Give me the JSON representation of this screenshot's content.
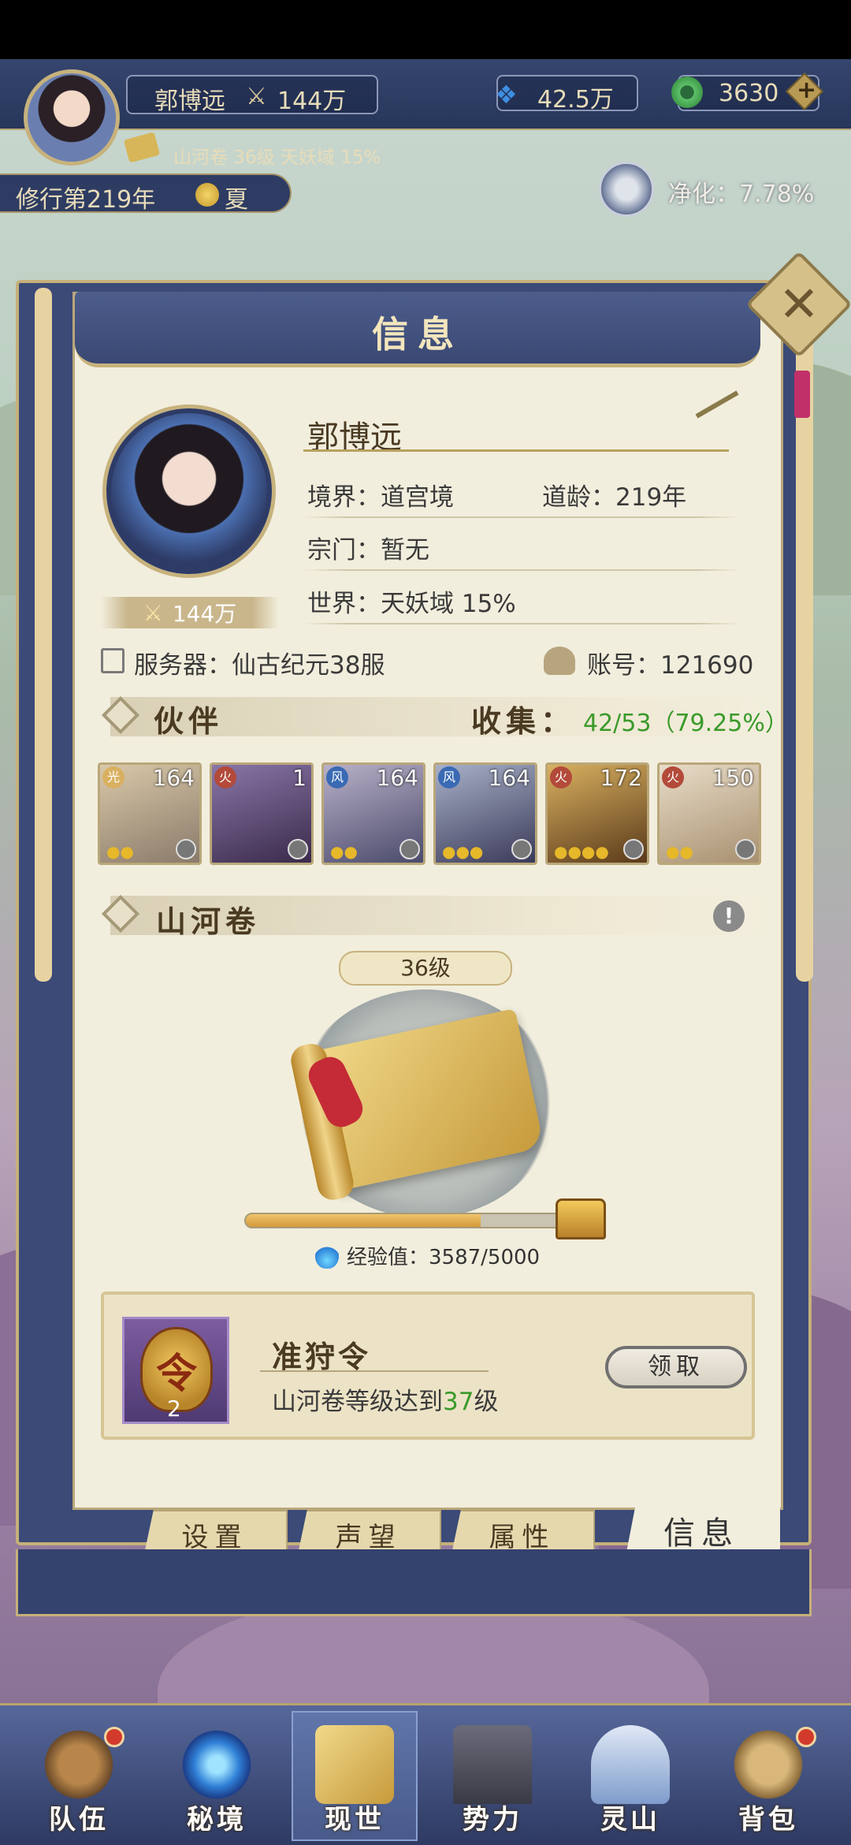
{
  "hud": {
    "player_name": "郭博远",
    "power": "144万",
    "gems": "42.5万",
    "jade": "3630",
    "plus": "+",
    "sub_info": "山河卷 36级  天妖域 15%",
    "year": "修行第219年",
    "season": "夏",
    "purify": "净化：7.78%"
  },
  "dialog": {
    "title": "信息",
    "close": "✕",
    "name": "郭博远",
    "realm": "境界：道宫境",
    "age": "道龄：219年",
    "sect": "宗门：暂无",
    "world": "世界：天妖域  15%",
    "power": "144万",
    "server": "服务器：仙古纪元38服",
    "account": "账号：121690",
    "partners_title": "伙伴",
    "collect_label": "收集：",
    "collect_value": "42/53（79.25%）",
    "partners": [
      {
        "level": "164",
        "stars": 2,
        "element": "light"
      },
      {
        "level": "1",
        "stars": 0,
        "element": "fire"
      },
      {
        "level": "164",
        "stars": 2,
        "element": "wind"
      },
      {
        "level": "164",
        "stars": 3,
        "element": "wind"
      },
      {
        "level": "172",
        "stars": 4,
        "element": "fire"
      },
      {
        "level": "150",
        "stars": 2,
        "element": "fire"
      }
    ],
    "scroll_title": "山河卷",
    "info_mark": "!",
    "scroll_level": "36级",
    "exp_label": "经验值：3587/5000",
    "exp_fraction": 0.7174,
    "task_title": "准狩令",
    "task_desc_prefix": "山河卷等级达到",
    "task_desc_level": "37",
    "task_desc_suffix": "级",
    "task_count": "2",
    "claim": "领取"
  },
  "tabs": [
    "设置",
    "声望",
    "属性",
    "信息"
  ],
  "nav": [
    "队伍",
    "秘境",
    "现世",
    "势力",
    "灵山",
    "背包"
  ],
  "colors": {
    "accent_green": "#3a9a2a",
    "panel_bg": "#f2eedd",
    "frame_blue": "#3b4a77",
    "gold": "#c7b27d"
  }
}
